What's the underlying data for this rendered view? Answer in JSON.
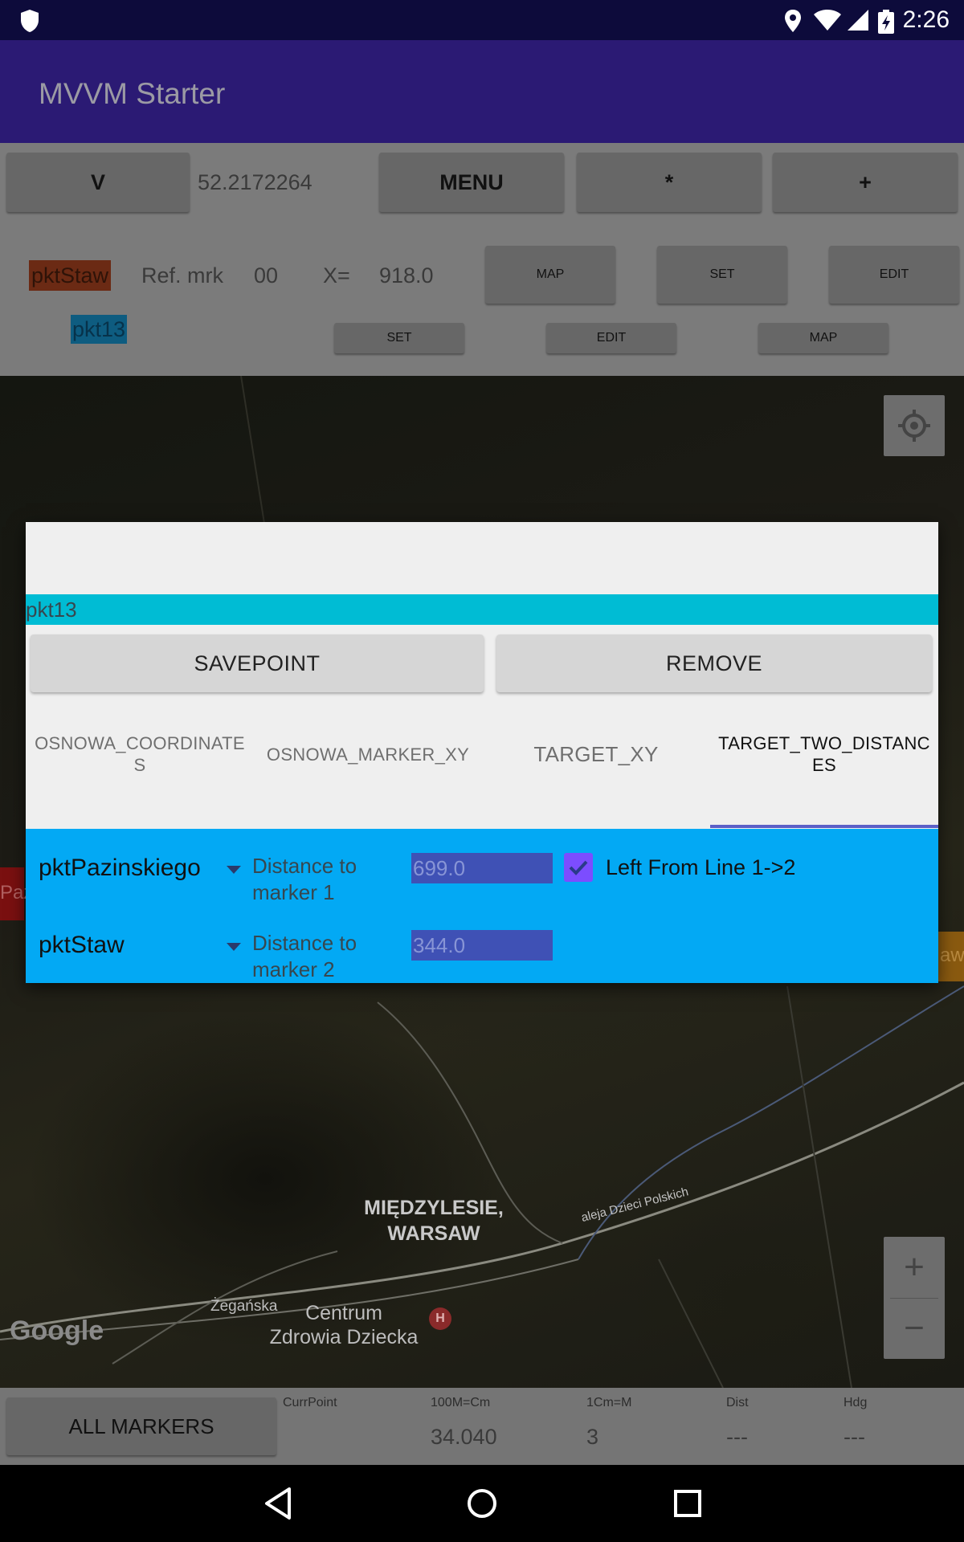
{
  "status_bar": {
    "time": "2:26"
  },
  "app_bar": {
    "title": "MVVM Starter"
  },
  "toolbar": {
    "v_label": "V",
    "coord_value": "52.2172264",
    "menu_label": "MENU",
    "star_label": "*",
    "plus_label": "+"
  },
  "ref_row": {
    "tag1": "pktStaw",
    "ref_label": "Ref. mrk",
    "ref_num": "00",
    "x_label": "X=",
    "x_value": "918.0",
    "map_label": "MAP",
    "set_label": "SET",
    "edit_label": "EDIT"
  },
  "second_row": {
    "tag2": "pkt13",
    "set_label": "SET",
    "edit_label": "EDIT",
    "map_label": "MAP"
  },
  "map": {
    "place_label_1": "MIĘDZYLESIE,",
    "place_label_2": "WARSAW",
    "street_label_1": "Żegańska",
    "street_label_2": "aleja Dzieci Polskich",
    "poi_label_1": "Centrum",
    "poi_label_2": "Zdrowia Dziecka",
    "poi_icon_letter": "H",
    "google_logo": "Google",
    "marker_left_text": "Paz",
    "marker_right_text": "aw",
    "zoom_in": "+",
    "zoom_out": "−"
  },
  "bottom_bar": {
    "all_markers_label": "ALL MARKERS",
    "curr_point_label": "CurrPoint",
    "scale_label": "100M=Cm",
    "cm_label": "1Cm=M",
    "dist_label": "Dist",
    "hdg_label": "Hdg",
    "scale_value": "34.040",
    "cm_value": "3",
    "dist_value": "---",
    "hdg_value": "---"
  },
  "dialog": {
    "title": "pkt13",
    "save_label": "SAVEPOINT",
    "remove_label": "REMOVE",
    "tabs": [
      {
        "label": "OSNOWA_COORDINATES"
      },
      {
        "label": "OSNOWA_MARKER_XY"
      },
      {
        "label": "TARGET_XY"
      },
      {
        "label": "TARGET_TWO_DISTANCES"
      }
    ],
    "active_tab": 3,
    "row1": {
      "marker": "pktPazinskiego",
      "label_line1": "Distance to",
      "label_line2": "marker 1",
      "value": "699.0"
    },
    "row2": {
      "marker": "pktStaw",
      "label_line1": "Distance to",
      "label_line2": "marker 2",
      "value": "344.0"
    },
    "checkbox_label": "Left From Line 1->2",
    "checkbox_checked": true
  },
  "colors": {
    "accent": "#03a9f4",
    "title_strip": "#00bcd4",
    "checkbox": "#7c4dff",
    "app_bar": "#2b1a74",
    "input": "#3f51b5"
  }
}
